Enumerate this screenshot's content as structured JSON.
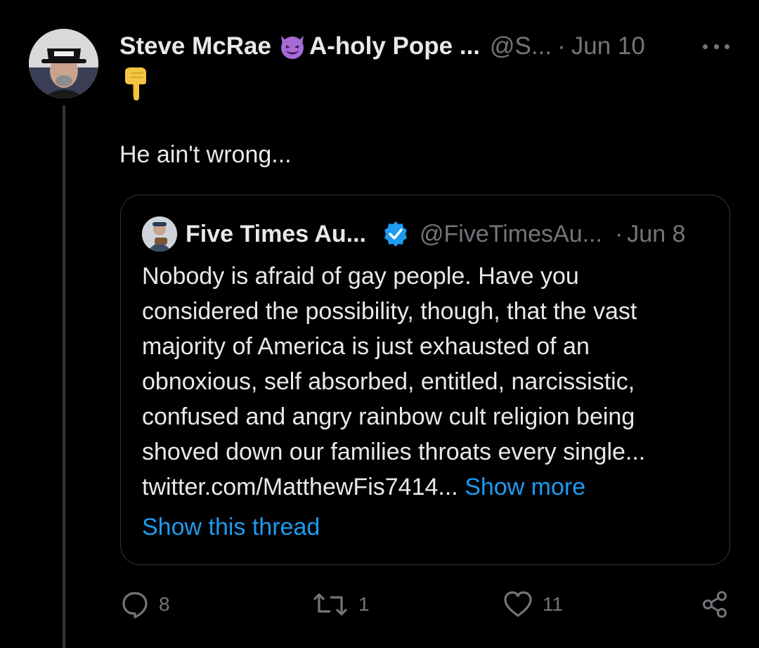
{
  "tweet": {
    "display_name": "Steve McRae",
    "display_name_suffix": "A-holy Pope ...",
    "handle": "@S...",
    "separator": "·",
    "date": "Jun 10",
    "text": "He ain't wrong..."
  },
  "quote": {
    "display_name": "Five Times Au...",
    "handle": "@FiveTimesAu...",
    "separator": "·",
    "date": "Jun 8",
    "lines": [
      "Nobody is afraid of gay people. Have you",
      "considered the possibility, though, that the vast",
      "majority of America is just exhausted of an",
      "obnoxious, self absorbed, entitled, narcissistic,",
      "confused and angry rainbow cult religion being",
      "shoved down our families throats every single..."
    ],
    "link_text": "twitter.com/MatthewFis7414...",
    "show_more": "Show more",
    "show_thread": "Show this thread"
  },
  "actions": {
    "replies": "8",
    "retweets": "1",
    "likes": "11"
  },
  "icons": {
    "devil_emoji": "smiling-face-with-horns-icon",
    "pointing_emoji": "backhand-index-pointing-down-icon",
    "verified": "verified-badge-icon",
    "reply": "reply-icon",
    "retweet": "retweet-icon",
    "like": "heart-icon",
    "share": "share-icon"
  },
  "colors": {
    "background": "#000000",
    "text": "#e7e9ea",
    "muted": "#71767b",
    "link": "#1d9bf0",
    "border": "#333639",
    "verified": "#1d9bf0"
  }
}
